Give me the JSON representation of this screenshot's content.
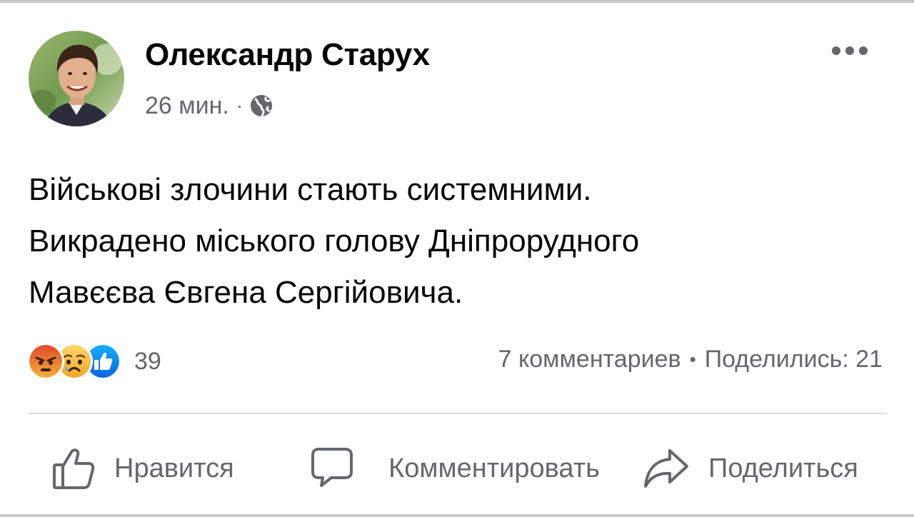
{
  "post": {
    "author_name": "Олександр Старух",
    "time": "26 мин.",
    "separator": "·",
    "audience_icon": "globe-icon",
    "text_lines": [
      "Військові злочини стають системними.",
      "Викрадено міського голову Дніпрорудного",
      "Мавєєва Євгена Сергійовича."
    ]
  },
  "reactions": {
    "icons": [
      "angry-reaction-icon",
      "sad-reaction-icon",
      "like-reaction-icon"
    ],
    "count": "39",
    "comments": "7 комментариев",
    "separator": "•",
    "shares": "Поделились: 21"
  },
  "actions": {
    "like_label": "Нравится",
    "comment_label": "Комментировать",
    "share_label": "Поделиться"
  },
  "colors": {
    "text_primary": "#050505",
    "text_secondary": "#65676b",
    "like_blue": "#1877f2",
    "angry_orange": "#e9710f",
    "sad_yellow": "#f7b125",
    "divider": "#dadde1"
  }
}
